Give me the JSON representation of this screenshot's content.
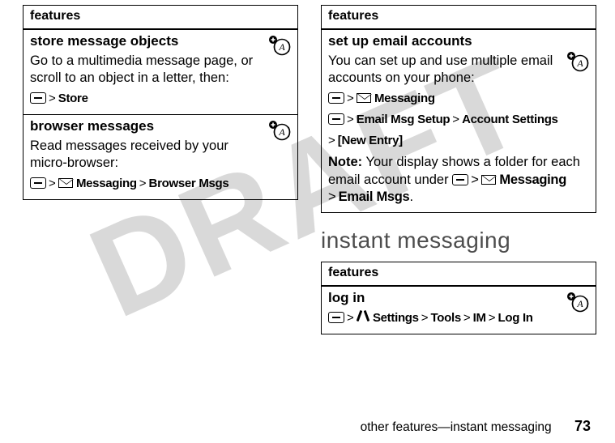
{
  "watermark": "DRAFT",
  "left": {
    "header": "features",
    "sections": [
      {
        "title": "store message objects",
        "body": "Go to a multimedia message page, or scroll to an object in a letter, then:",
        "nav_items": [
          "Store"
        ]
      },
      {
        "title": "browser messages",
        "body": "Read messages received by your micro-browser:",
        "nav_items": [
          "Messaging",
          "Browser Msgs"
        ]
      }
    ]
  },
  "right": {
    "header": "features",
    "section": {
      "title": "set up email accounts",
      "body": "You can set up and use multiple email accounts on your phone:",
      "nav_line1": [
        "Messaging"
      ],
      "nav_line2": [
        "Email Msg Setup",
        "Account Settings"
      ],
      "nav_line3": [
        "[New Entry]"
      ],
      "note_label": "Note:",
      "note_text_a": " Your display shows a folder for each email account under ",
      "note_mid": "Messaging",
      "note_end": "Email Msgs",
      "note_period": "."
    }
  },
  "heading": "instant messaging",
  "im_table": {
    "header": "features",
    "section": {
      "title": "log in",
      "nav": [
        "Settings",
        "Tools",
        "IM",
        "Log In"
      ]
    }
  },
  "footer": {
    "text": "other features—instant messaging",
    "page": "73"
  }
}
